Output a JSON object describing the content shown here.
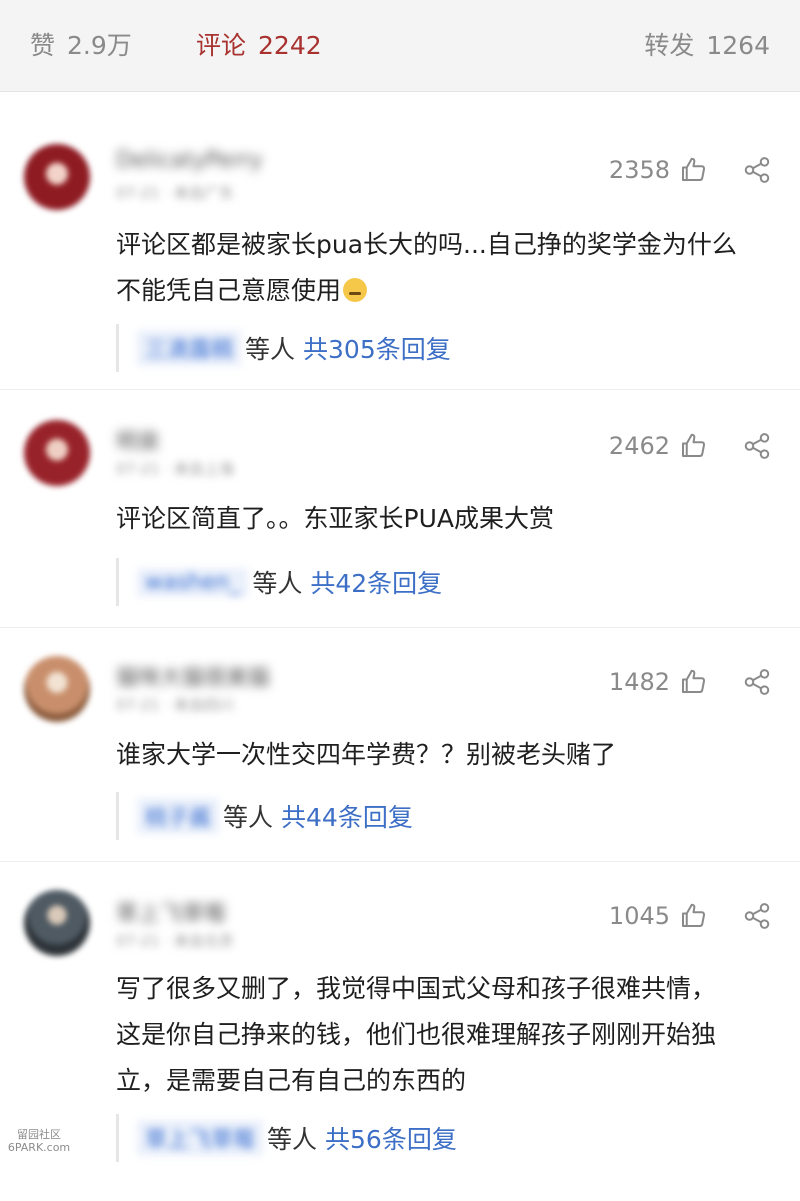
{
  "tabs": {
    "likes": {
      "label": "赞",
      "count": "2.9万"
    },
    "comments": {
      "label": "评论",
      "count": "2242"
    },
    "reposts": {
      "label": "转发",
      "count": "1264"
    }
  },
  "comments": [
    {
      "username": "DelicatyPerry",
      "meta": "07-21 · 来自广东",
      "likes": "2358",
      "text_lines": [
        "评论区都是被家长pua长大的吗...自己挣的奖学金为什么",
        "不能凭自己意愿使用"
      ],
      "reply_names": "三滴露稠",
      "reply_mid": "等人",
      "reply_total": "共305条回复"
    },
    {
      "username": "明泉",
      "meta": "07-21 · 来自上海",
      "likes": "2462",
      "text_lines": [
        "评论区简直了。。东亚家长PUA成果大赏"
      ],
      "reply_names": "washen_",
      "reply_mid": "等人",
      "reply_total": "共42条回复"
    },
    {
      "username": "猫咪大猫很美猫",
      "meta": "07-21 · 来自四川",
      "likes": "1482",
      "text_lines": [
        "谁家大学一次性交四年学费？？别被老头赌了"
      ],
      "reply_names": "桃子酱",
      "reply_mid": "等人",
      "reply_total": "共44条回复"
    },
    {
      "username": "草上飞草莓",
      "meta": "07-21 · 来自北京",
      "likes": "1045",
      "text_lines": [
        "写了很多又删了，我觉得中国式父母和孩子很难共情，",
        "这是你自己挣来的钱，他们也很难理解孩子刚刚开始独",
        "立，是需要自己有自己的东西的"
      ],
      "reply_names": "草上飞草莓",
      "reply_mid": "等人",
      "reply_total": "共56条回复"
    }
  ],
  "watermark": {
    "line1": "留园社区",
    "line2": "6PARK.com"
  },
  "colors": {
    "accent": "#a8322f",
    "link": "#3d6fc6",
    "muted": "#8a8a8a"
  },
  "icons": {
    "like": "thumbs-up-icon",
    "share": "share-icon",
    "emoji": "grinning-face-emoji"
  }
}
